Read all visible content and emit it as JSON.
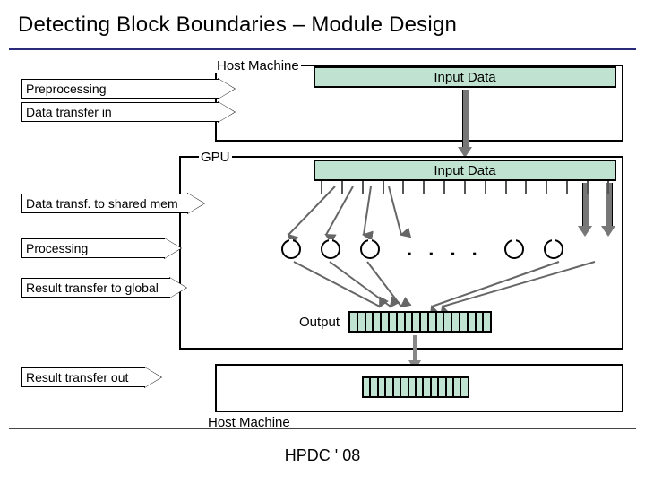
{
  "title": "Detecting Block Boundaries – Module Design",
  "footer": "HPDC ' 08",
  "host_top_label": "Host Machine",
  "gpu_label": "GPU",
  "host_bot_label": "Host Machine",
  "input_bar_1": "Input Data",
  "input_bar_2": "Input Data",
  "output_label": "Output",
  "ellipsis": ". . . .",
  "steps": [
    "Preprocessing",
    "Data transfer in",
    "Data transf. to shared mem",
    "Processing",
    "Result transfer to global",
    "Result transfer out"
  ]
}
